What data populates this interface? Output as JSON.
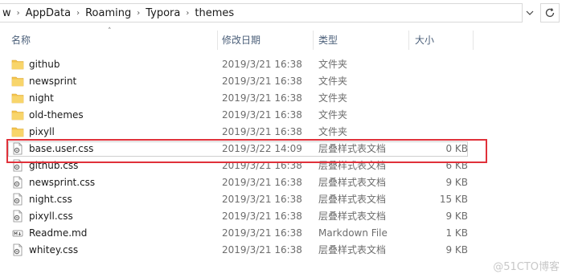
{
  "address_bar": {
    "crumbs": [
      "w",
      "AppData",
      "Roaming",
      "Typora",
      "themes"
    ],
    "dropdown_icon": "chevron-down-icon",
    "refresh_icon": "refresh-icon"
  },
  "columns": {
    "name": "名称",
    "date_modified": "修改日期",
    "type": "类型",
    "size": "大小"
  },
  "files": [
    {
      "name": "github",
      "date": "2019/3/21 16:38",
      "type": "文件夹",
      "size": "",
      "icon": "folder-icon"
    },
    {
      "name": "newsprint",
      "date": "2019/3/21 16:38",
      "type": "文件夹",
      "size": "",
      "icon": "folder-icon"
    },
    {
      "name": "night",
      "date": "2019/3/21 16:38",
      "type": "文件夹",
      "size": "",
      "icon": "folder-icon"
    },
    {
      "name": "old-themes",
      "date": "2019/3/21 16:38",
      "type": "文件夹",
      "size": "",
      "icon": "folder-icon"
    },
    {
      "name": "pixyll",
      "date": "2019/3/21 16:38",
      "type": "文件夹",
      "size": "",
      "icon": "folder-icon"
    },
    {
      "name": "base.user.css",
      "date": "2019/3/22 14:09",
      "type": "层叠样式表文档",
      "size": "0 KB",
      "icon": "css-file-icon",
      "selected": true
    },
    {
      "name": "github.css",
      "date": "2019/3/21 16:38",
      "type": "层叠样式表文档",
      "size": "6 KB",
      "icon": "css-file-icon"
    },
    {
      "name": "newsprint.css",
      "date": "2019/3/21 16:38",
      "type": "层叠样式表文档",
      "size": "9 KB",
      "icon": "css-file-icon"
    },
    {
      "name": "night.css",
      "date": "2019/3/21 16:38",
      "type": "层叠样式表文档",
      "size": "15 KB",
      "icon": "css-file-icon"
    },
    {
      "name": "pixyll.css",
      "date": "2019/3/21 16:38",
      "type": "层叠样式表文档",
      "size": "9 KB",
      "icon": "css-file-icon"
    },
    {
      "name": "Readme.md",
      "date": "2019/3/21 16:38",
      "type": "Markdown File",
      "size": "1 KB",
      "icon": "markdown-file-icon"
    },
    {
      "name": "whitey.css",
      "date": "2019/3/21 16:38",
      "type": "层叠样式表文档",
      "size": "9 KB",
      "icon": "css-file-icon"
    }
  ],
  "watermark": "@51CTO博客",
  "colors": {
    "folder": "#f4c44e",
    "highlight_border": "#e0313a",
    "header_text": "#4c607a"
  }
}
